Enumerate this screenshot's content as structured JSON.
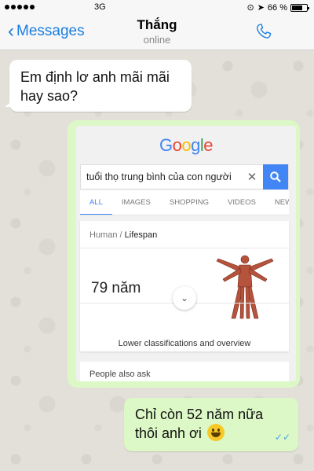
{
  "status_bar": {
    "network": "3G",
    "battery": "66 %"
  },
  "nav": {
    "back_label": "Messages",
    "contact_name": "Thắng",
    "contact_status": "online"
  },
  "messages": [
    {
      "direction": "incoming",
      "text_line1": "Em định lơ anh mãi mãi",
      "text_line2": "hay sao?"
    },
    {
      "direction": "outgoing",
      "text_line1": "Chỉ còn 52 năm nữa",
      "text_line2": "thôi anh ơi"
    }
  ],
  "google_card": {
    "logo": [
      "G",
      "o",
      "o",
      "g",
      "l",
      "e"
    ],
    "logo_colors": [
      "#4285f4",
      "#ea4335",
      "#fbbc05",
      "#4285f4",
      "#34a853",
      "#ea4335"
    ],
    "query": "tuổi thọ trung bình của con người",
    "tabs": [
      "ALL",
      "IMAGES",
      "SHOPPING",
      "VIDEOS",
      "NEW"
    ],
    "breadcrumb_parent": "Human",
    "breadcrumb_sep": "/",
    "breadcrumb_current": "Lifespan",
    "answer": "79 năm",
    "lower_link": "Lower classifications and overview",
    "people_also_ask": "People also ask"
  }
}
